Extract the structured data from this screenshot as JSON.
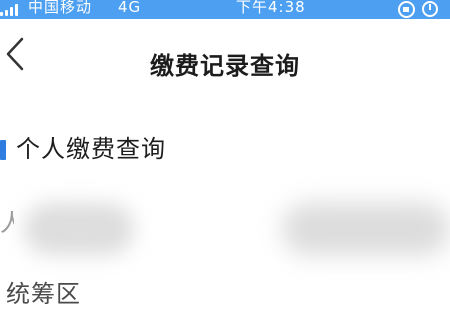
{
  "status_bar": {
    "carrier": "中国移动",
    "network": "4G",
    "time": "下午4:38",
    "icons": [
      "signal-icon",
      "screen-lock-icon",
      "alarm-icon"
    ],
    "background_color": "#4d9ff2"
  },
  "nav": {
    "title": "缴费记录查询",
    "back_icon": "chevron-left-icon"
  },
  "section": {
    "title": "个人缴费查询",
    "accent_color": "#2f7de1"
  },
  "form": {
    "partial_label": "人",
    "district_label": "统筹区"
  }
}
